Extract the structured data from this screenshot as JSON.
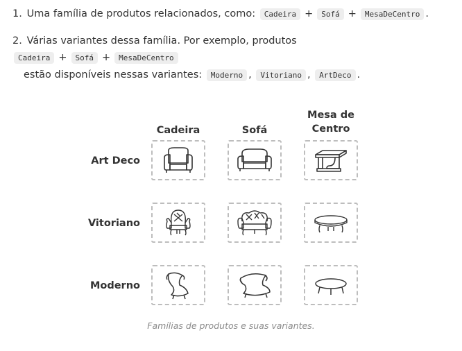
{
  "list": {
    "item1": {
      "number": "1.",
      "text": "Uma família de produtos relacionados, como:",
      "tokens": [
        "Cadeira",
        "Sofá",
        "MesaDeCentro"
      ],
      "plus": "+",
      "end": "."
    },
    "item2": {
      "number": "2.",
      "text": "Várias variantes dessa família. Por exemplo, produtos",
      "tokens": [
        "Cadeira",
        "Sofá",
        "MesaDeCentro"
      ],
      "plus": "+",
      "text2": "estão disponíveis nessas variantes:",
      "variants": [
        "Moderno",
        "Vitoriano",
        "ArtDeco"
      ],
      "comma": ",",
      "end": "."
    }
  },
  "figure": {
    "columns": [
      "Cadeira",
      "Sofá",
      "Mesa de\nCentro"
    ],
    "rows": [
      "Art Deco",
      "Vitoriano",
      "Moderno"
    ],
    "cells_icons": [
      [
        "armchair-artdeco-icon",
        "sofa-artdeco-icon",
        "table-artdeco-icon"
      ],
      [
        "armchair-victorian-icon",
        "sofa-victorian-icon",
        "table-victorian-icon"
      ],
      [
        "chair-modern-icon",
        "sofa-modern-icon",
        "table-modern-icon"
      ]
    ],
    "caption": "Famílias de produtos e suas variantes."
  }
}
